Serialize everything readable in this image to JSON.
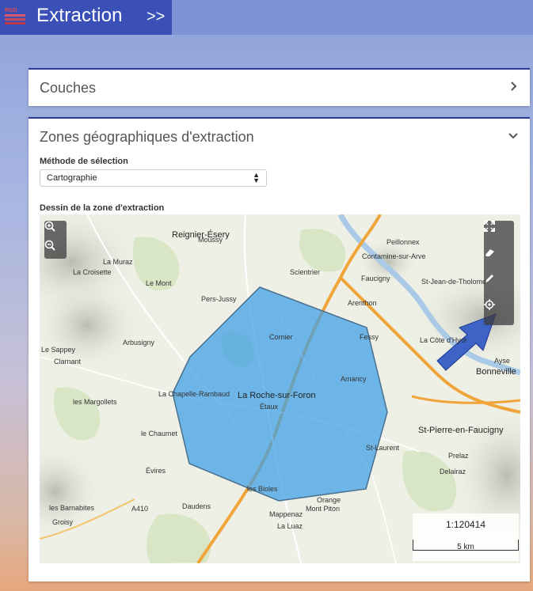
{
  "header": {
    "logo_text": "RGD",
    "title": "Extraction",
    "collapse_label": ">>"
  },
  "panels": {
    "layers": {
      "title": "Couches"
    },
    "zones": {
      "title": "Zones géographiques d'extraction",
      "selection_method_label": "Méthode de sélection",
      "selection_method_value": "Cartographie",
      "drawing_label": "Dessin de la zone d'extraction"
    }
  },
  "map": {
    "scale_ratio": "1:120414",
    "scale_distance": "5 km",
    "labels": [
      {
        "text": "Reignier-Ésery",
        "big": true
      },
      {
        "text": "Contamine-sur-Arve",
        "big": false
      },
      {
        "text": "Pers-Jussy",
        "big": false
      },
      {
        "text": "Arbusigny",
        "big": false
      },
      {
        "text": "La Roche-sur-Foron",
        "big": true
      },
      {
        "text": "Amancy",
        "big": false
      },
      {
        "text": "Bonneville",
        "big": true
      },
      {
        "text": "St-Pierre-en-Faucigny",
        "big": true
      },
      {
        "text": "Arenthon",
        "big": false
      },
      {
        "text": "Faucigny",
        "big": false
      },
      {
        "text": "La Muraz",
        "big": false
      },
      {
        "text": "La Chapelle-Rambaud",
        "big": false
      },
      {
        "text": "les Margollets",
        "big": false
      },
      {
        "text": "le Chaumet",
        "big": false
      },
      {
        "text": "Évires",
        "big": false
      },
      {
        "text": "Groisy",
        "big": false
      },
      {
        "text": "Mont Piton",
        "big": false
      },
      {
        "text": "St-Laurent",
        "big": false
      },
      {
        "text": "Étaux",
        "big": false
      },
      {
        "text": "Moussy",
        "big": false
      },
      {
        "text": "Scientrier",
        "big": false
      },
      {
        "text": "Peillonnex",
        "big": false
      },
      {
        "text": "St-Jean-de-Tholome",
        "big": false
      },
      {
        "text": "Le Mont",
        "big": false
      },
      {
        "text": "La Croisette",
        "big": false
      },
      {
        "text": "Daudens",
        "big": false
      },
      {
        "text": "Mappenaz",
        "big": false
      },
      {
        "text": "La Luaz",
        "big": false
      },
      {
        "text": "Orange",
        "big": false
      },
      {
        "text": "Delairaz",
        "big": false
      },
      {
        "text": "Prelaz",
        "big": false
      },
      {
        "text": "les Barnabites",
        "big": false
      },
      {
        "text": "Le Sappey",
        "big": false
      },
      {
        "text": "Clarnant",
        "big": false
      },
      {
        "text": "La Côte d'Hyot",
        "big": false
      },
      {
        "text": "Ayse",
        "big": false
      },
      {
        "text": "Fessy",
        "big": false
      },
      {
        "text": "Cornier",
        "big": false
      },
      {
        "text": "les Bioles",
        "big": false
      },
      {
        "text": "A410",
        "big": false
      }
    ]
  },
  "colors": {
    "title_bg": "#3a50b7",
    "polygon_fill": "#3c9ee6",
    "arrow": "#3d63c7"
  }
}
